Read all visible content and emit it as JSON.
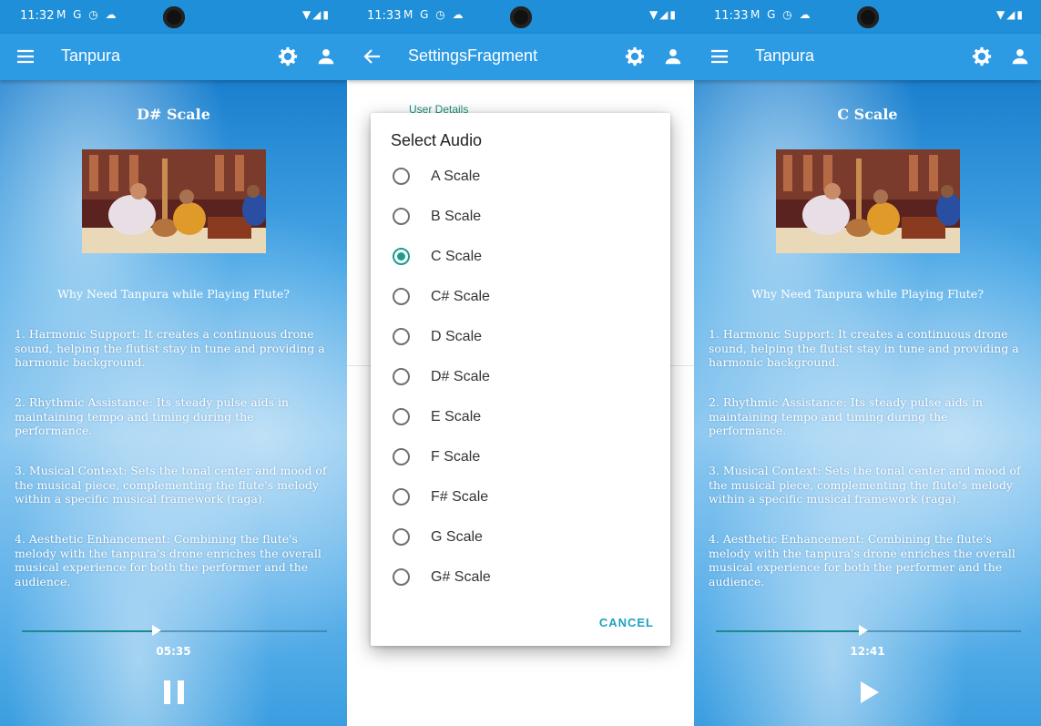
{
  "screens": [
    {
      "status": {
        "time": "11:32",
        "notif_icons": "M G ◷ ☁",
        "sys_icons": "▼◢▮"
      },
      "appbar": {
        "title": "Tanpura"
      },
      "scale_title": "D# Scale",
      "why_heading": "Why Need Tanpura while Playing Flute?",
      "paragraphs": [
        "1. Harmonic Support: It creates a continuous drone sound, helping the flutist stay in tune and providing a harmonic background.",
        "2. Rhythmic Assistance: Its steady pulse aids in maintaining tempo and timing during the performance.",
        "3. Musical Context: Sets the tonal center and mood of the musical piece, complementing the flute's melody within a specific musical framework (raga).",
        "4. Aesthetic Enhancement: Combining the flute's melody with the tanpura's drone enriches the overall musical experience for both the performer and the audience."
      ],
      "player": {
        "elapsed": "05:35",
        "progress": 0.44,
        "state": "playing",
        "button_icon": "pause-icon"
      }
    },
    {
      "status": {
        "time": "11:33",
        "notif_icons": "M G ◷ ☁",
        "sys_icons": "▼◢▮"
      },
      "appbar": {
        "title": "SettingsFragment"
      },
      "section_label": "User Details",
      "dialog": {
        "title": "Select Audio",
        "options": [
          "A Scale",
          "B Scale",
          "C Scale",
          "C# Scale",
          "D Scale",
          "D# Scale",
          "E Scale",
          "F Scale",
          "F# Scale",
          "G Scale",
          "G# Scale"
        ],
        "selected": "C Scale",
        "cancel_label": "CANCEL"
      }
    },
    {
      "status": {
        "time": "11:33",
        "notif_icons": "M G ◷ ☁",
        "sys_icons": "▼◢▮"
      },
      "appbar": {
        "title": "Tanpura"
      },
      "scale_title": "C Scale",
      "why_heading": "Why Need Tanpura while Playing Flute?",
      "paragraphs": [
        "1. Harmonic Support: It creates a continuous drone sound, helping the flutist stay in tune and providing a harmonic background.",
        "2. Rhythmic Assistance: Its steady pulse aids in maintaining tempo and timing during the performance.",
        "3. Musical Context: Sets the tonal center and mood of the musical piece, complementing the flute's melody within a specific musical framework (raga).",
        "4. Aesthetic Enhancement: Combining the flute's melody with the tanpura's drone enriches the overall musical experience for both the performer and the audience."
      ],
      "player": {
        "elapsed": "12:41",
        "progress": 0.48,
        "state": "paused",
        "button_icon": "play-icon"
      }
    }
  ],
  "colors": {
    "appbar": "#2d9ae4",
    "statusbar": "#1e8fd8",
    "accent": "#1b9c8e",
    "cancel": "#1ba1c4"
  }
}
